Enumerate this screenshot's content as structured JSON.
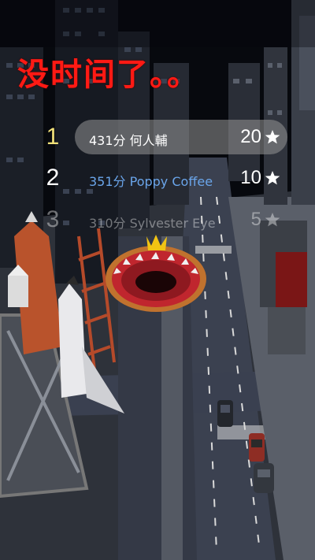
{
  "banner": {
    "text": "没时间了。。"
  },
  "leaderboard": [
    {
      "rank": "1",
      "name": "431分 何人輔",
      "score": "20",
      "icon": "star-icon",
      "highlight": true
    },
    {
      "rank": "2",
      "name": "351分 Poppy Coffee",
      "score": "10",
      "icon": "star-icon"
    },
    {
      "rank": "3",
      "name": "310分 Sylvester Eye",
      "score": "5",
      "icon": "star-icon"
    }
  ],
  "colors": {
    "banner": "#ff1a14",
    "first_rank": "#f3e27a",
    "player_name": "#6aa5ea",
    "hole_inner": "#c0262e",
    "road": "#3b4150"
  }
}
